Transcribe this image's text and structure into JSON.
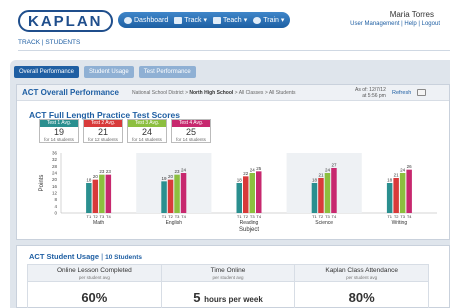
{
  "header": {
    "logo": "KAPLAN",
    "nav": [
      {
        "label": "Dashboard",
        "icon": "dashboard-icon"
      },
      {
        "label": "Track",
        "icon": "chart-icon"
      },
      {
        "label": "Teach",
        "icon": "tv-icon"
      },
      {
        "label": "Train",
        "icon": "cloud-icon"
      }
    ],
    "user_name": "Maria Torres",
    "user_links": "User Management  |  Help  |  Logout",
    "section": "TRACK | STUDENTS"
  },
  "tabs": [
    {
      "label": "Overall Performance",
      "active": true
    },
    {
      "label": "Student Usage",
      "active": false
    },
    {
      "label": "Test Performance",
      "active": false
    }
  ],
  "overall": {
    "title": "ACT Overall Performance",
    "breadcrumb_pre": "National School District > ",
    "breadcrumb_bold": "North High School",
    "breadcrumb_post": " > All Classes > All Students",
    "as_of_1": "As of: 12/7/12",
    "as_of_2": "at 5:56 pm",
    "refresh": "Refresh"
  },
  "scores": {
    "title": "ACT Full Length Practice Test Scores",
    "badges": [
      {
        "label": "Test 1 Avg.",
        "value": "19",
        "sub": "for 14 students",
        "color": "#2a8f8f"
      },
      {
        "label": "Test 2 Avg.",
        "value": "21",
        "sub": "for 12 students",
        "color": "#d83a3a"
      },
      {
        "label": "Test 3 Avg.",
        "value": "24",
        "sub": "for 14 students",
        "color": "#8cbf3f"
      },
      {
        "label": "Test 4 Avg.",
        "value": "25",
        "sub": "for 14 students",
        "color": "#c7286e"
      }
    ]
  },
  "chart_data": {
    "type": "bar",
    "ylabel": "Points",
    "xlabel": "Subject",
    "ylim": [
      0,
      36
    ],
    "yticks": [
      0,
      4,
      8,
      12,
      16,
      20,
      24,
      28,
      32,
      36
    ],
    "categories": [
      "Math",
      "English",
      "Reading",
      "Science",
      "Writing"
    ],
    "bar_labels": [
      "T1",
      "T2",
      "T3",
      "T4"
    ],
    "colors": [
      "#2a8f8f",
      "#d83a3a",
      "#8cbf3f",
      "#c7286e"
    ],
    "series": [
      {
        "values": [
          18,
          19,
          18,
          18,
          18
        ]
      },
      {
        "values": [
          20,
          20,
          22,
          21,
          21
        ]
      },
      {
        "values": [
          23,
          23,
          24,
          24,
          24
        ]
      },
      {
        "values": [
          23,
          24,
          25,
          27,
          26
        ]
      }
    ]
  },
  "usage": {
    "title": "ACT Student Usage",
    "count": "10 Students",
    "stats": [
      {
        "label": "Online Lesson Completed",
        "sub": "per student avg",
        "value": "60%",
        "unit": ""
      },
      {
        "label": "Time Online",
        "sub": "per student avg",
        "value": "5",
        "unit": "hours per week"
      },
      {
        "label": "Kaplan Class Attendance",
        "sub": "per student avg",
        "value": "80%",
        "unit": ""
      }
    ]
  }
}
